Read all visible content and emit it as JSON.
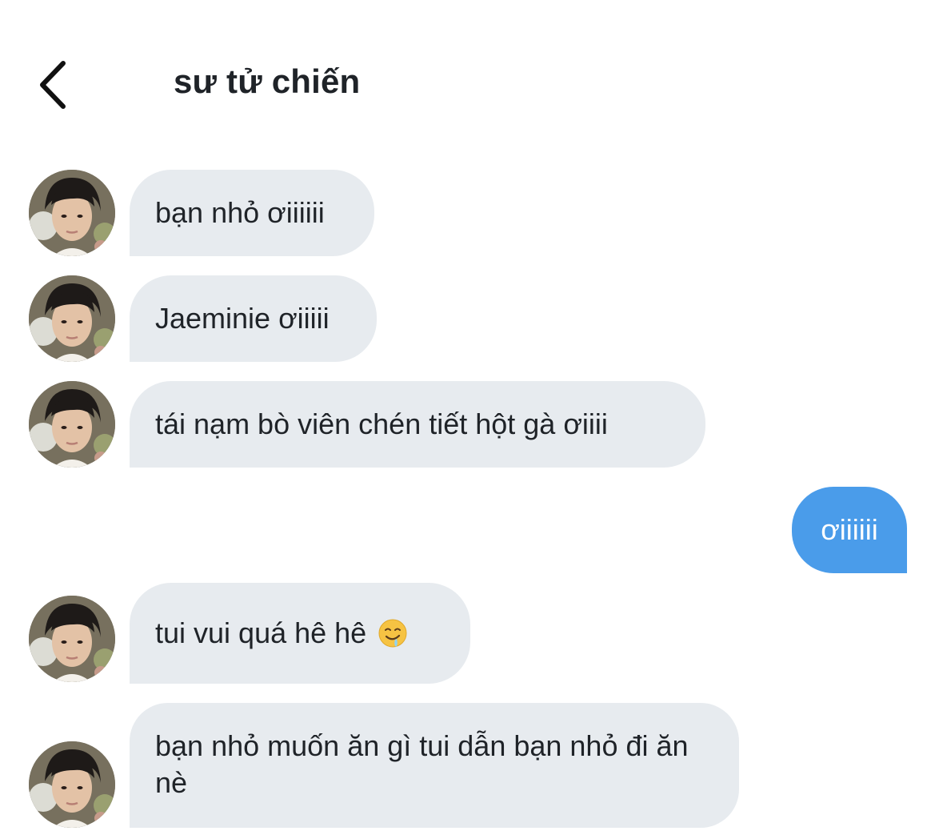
{
  "header": {
    "back_icon": "chevron-left-icon",
    "title": "sư tử chiến"
  },
  "messages": [
    {
      "from": "contact",
      "text": "bạn nhỏ ơiiiiii"
    },
    {
      "from": "contact",
      "text": "Jaeminie ơiiiii"
    },
    {
      "from": "contact",
      "text": "tái nạm bò viên chén tiết hột gà ơiiii"
    },
    {
      "from": "me",
      "text": "ơiiiiii"
    },
    {
      "from": "contact",
      "text": "tui vui quá hê hê",
      "emoji": "drooling-face-emoji"
    },
    {
      "from": "contact",
      "text": "bạn nhỏ muốn ăn gì tui dẫn bạn nhỏ đi ăn nè"
    }
  ],
  "colors": {
    "incoming_bubble": "#e7ebef",
    "outgoing_bubble": "#4a9cea",
    "text": "#1f2328"
  }
}
